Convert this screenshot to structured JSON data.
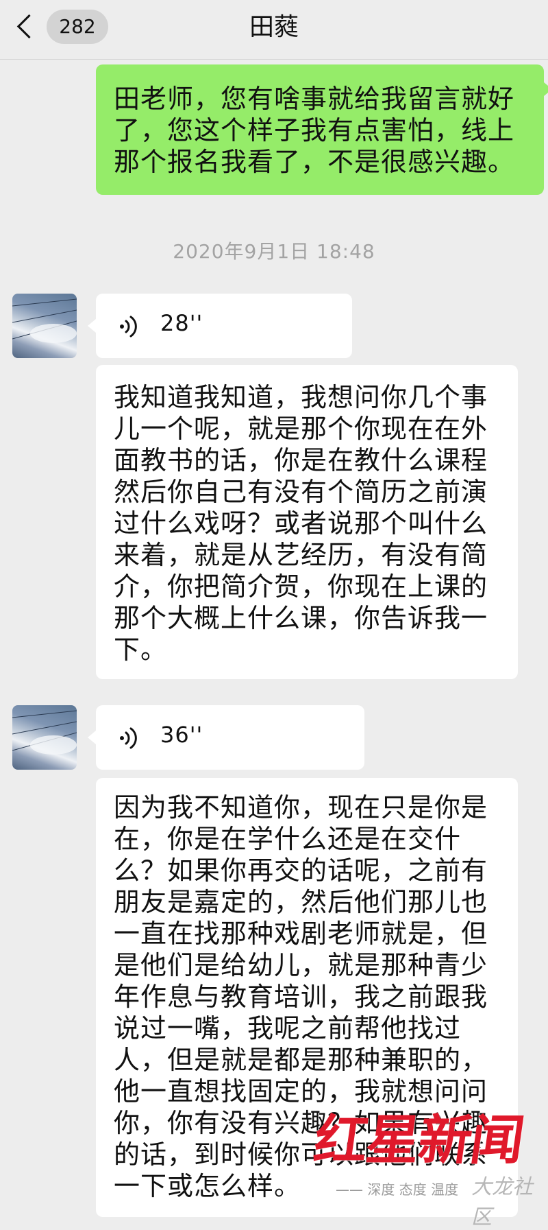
{
  "header": {
    "back_icon": "chevron-left-icon",
    "unread_count": "282",
    "title": "田蕤"
  },
  "messages": [
    {
      "direction": "outgoing",
      "type": "text",
      "lines": [
        "田老师，您有啥事就给我留言就好",
        "了，您这个样子我有点害怕，线上",
        "那个报名我看了，不是很感兴趣。"
      ]
    },
    {
      "type": "timestamp",
      "text": "2020年9月1日 18:48"
    },
    {
      "direction": "incoming",
      "type": "voice",
      "duration": "28''"
    },
    {
      "direction": "incoming",
      "type": "text",
      "lines": [
        "我知道我知道，我想问你几个事",
        "儿一个呢，就是那个你现在在外",
        "面教书的话，你是在教什么课程",
        "然后你自己有没有个简历之前演",
        "过什么戏呀？或者说那个叫什么",
        "来着，就是从艺经历，有没有简",
        "介，你把简介贺，你现在上课的",
        "那个大概上什么课，你告诉我一",
        "下。"
      ]
    },
    {
      "direction": "incoming",
      "type": "voice",
      "duration": "36''"
    },
    {
      "direction": "incoming",
      "type": "text",
      "lines": [
        "因为我不知道你，现在只是你是",
        "在，你是在学什么还是在交什",
        "么？如果你再交的话呢，之前有",
        "朋友是嘉定的，然后他们那儿也",
        "一直在找那种戏剧老师就是，但",
        "是他们是给幼儿，就是那种青少",
        "年作息与教育培训，我之前跟我",
        "说过一嘴，我呢之前帮他找过",
        "人，但是就是都是那种兼职的，",
        "他一直想找固定的，我就想问问",
        "你，你有没有兴趣？如果有兴趣",
        "的话，到时候你可以跟他们联系",
        "一下或怎么样。"
      ]
    }
  ],
  "watermark": {
    "brand": "红星新闻",
    "tagline": "—— 深度 态度 温度",
    "site": "大龙社区"
  },
  "colors": {
    "background": "#ededed",
    "outgoing_bubble": "#95ec69",
    "incoming_bubble": "#ffffff",
    "timestamp_text": "#a3a3a3",
    "watermark_red": "#e0192b"
  }
}
